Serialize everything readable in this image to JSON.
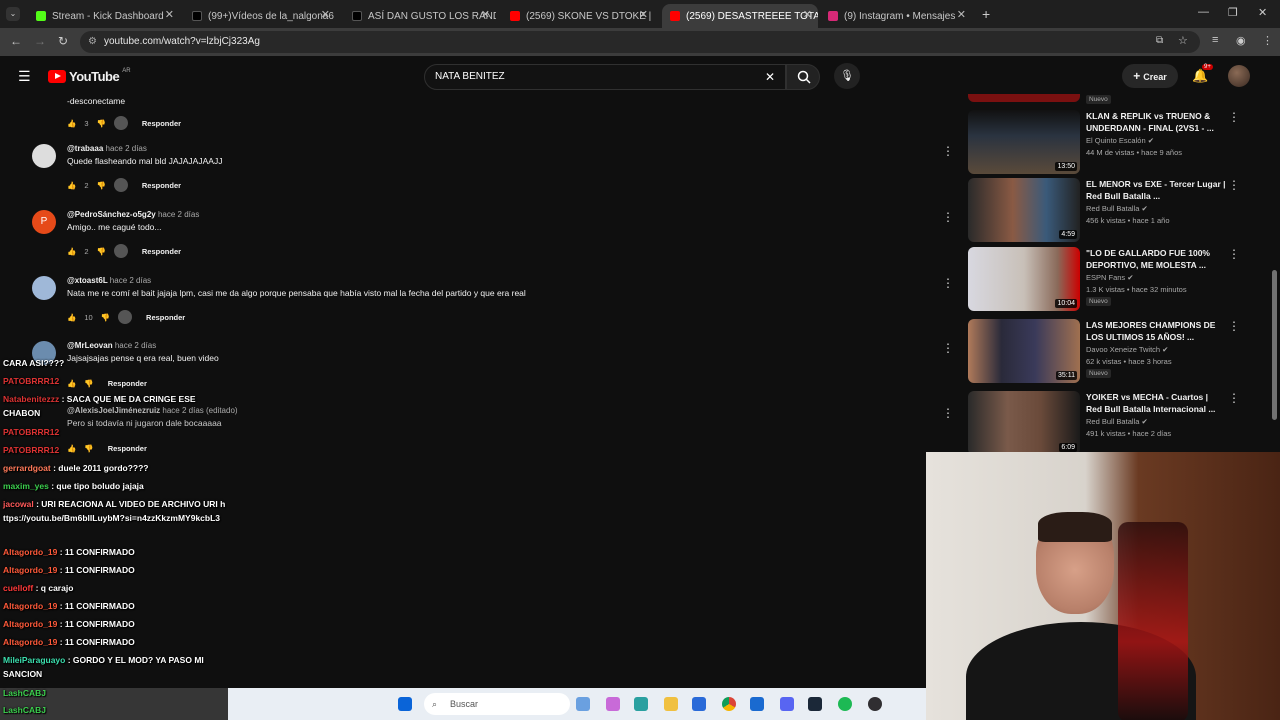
{
  "browser": {
    "tabs": [
      {
        "label": "Stream - Kick Dashboard",
        "color": "#53fc18"
      },
      {
        "label": "(99+)Vídeos de la_nalgona6 (@",
        "color": "#000000"
      },
      {
        "label": "ASÍ DAN GUSTO LOS RANDOM",
        "color": "#000000"
      },
      {
        "label": "(2569) SKONE VS DTOKE | FMS",
        "color": "#ff0000"
      },
      {
        "label": "(2569) DESASTREEEE TOTAL / B",
        "color": "#ff0000"
      },
      {
        "label": "(9) Instagram • Mensajes",
        "color": "#d62976"
      }
    ],
    "url": "youtube.com/watch?v=lzbjCj323Ag"
  },
  "youtube": {
    "logo_text": "YouTube",
    "region": "AR",
    "search_value": "NATA BENITEZ",
    "create_label": "Crear",
    "notif_count": "9+"
  },
  "comments": [
    {
      "author": "",
      "time": "",
      "text": "-desconectame",
      "likes": "3",
      "reply": "Responder"
    },
    {
      "author": "@trabaaa",
      "time": "hace 2 días",
      "text": "Quede flasheando mal bld JAJAJAJAAJJ",
      "likes": "2",
      "reply": "Responder"
    },
    {
      "author": "@PedroSánchez-o5g2y",
      "time": "hace 2 días",
      "text": "Amigo.. me cagué todo...",
      "likes": "2",
      "reply": "Responder"
    },
    {
      "author": "@xtoast6L",
      "time": "hace 2 días",
      "text": "Nata me re comí el bait jajaja lpm, casi me da algo porque pensaba que había visto mal la fecha del partido y que era real",
      "likes": "10",
      "reply": "Responder"
    },
    {
      "author": "@MrLeovan",
      "time": "hace 2 días",
      "text": "Jajsajsajas pense q era real, buen video",
      "likes": "",
      "reply": "Responder"
    },
    {
      "author": "@AlexisJoelJiménezruiz",
      "time": "hace 2 días (editado)",
      "text": "Pero si todavía ni jugaron   dale bocaaaaa",
      "likes": "",
      "reply": "Responder"
    }
  ],
  "sidebar_videos": [
    {
      "title": "KLAN & REPLIK vs TRUENO & UNDERDANN - FINAL (2VS1 - ...",
      "channel": "El Quinto Escalón",
      "meta": "44 M de vistas • hace 9 años",
      "duration": "13:50",
      "badge": ""
    },
    {
      "title": "EL MENOR vs EXE - Tercer Lugar | Red Bull Batalla ...",
      "channel": "Red Bull Batalla",
      "meta": "456 k vistas • hace 1 año",
      "duration": "4:59",
      "badge": ""
    },
    {
      "title": "\"LO DE GALLARDO FUE 100% DEPORTIVO, ME MOLESTA ...",
      "channel": "ESPN Fans",
      "meta": "1.3 K vistas • hace 32 minutos",
      "duration": "10:04",
      "badge": "Nuevo"
    },
    {
      "title": "LAS MEJORES CHAMPIONS DE LOS ULTIMOS 15 AÑOS! ...",
      "channel": "Davoo Xeneize Twitch",
      "meta": "62 k vistas • hace 3 horas",
      "duration": "35:11",
      "badge": "Nuevo"
    },
    {
      "title": "YOIKER vs MECHA - Cuartos | Red Bull Batalla Internacional ...",
      "channel": "Red Bull Batalla",
      "meta": "491 k vistas • hace 2 días",
      "duration": "6:09",
      "badge": ""
    }
  ],
  "top_badge": "Nuevo",
  "chat": [
    {
      "user": "",
      "msg": "CARA ASI????"
    },
    {
      "user": "PATOBRRR12",
      "msg": ""
    },
    {
      "user": "Natabenitezzz",
      "msg": "SACA QUE ME DA CRINGE ESE CHABON"
    },
    {
      "user": "PATOBRRR12",
      "msg": ""
    },
    {
      "user": "PATOBRRR12",
      "msg": ""
    },
    {
      "user": "gerrardgoat",
      "msg": "duele 2011 gordo????"
    },
    {
      "user": "maxim_yes",
      "msg": "que tipo boludo jajaja"
    },
    {
      "user": "jacowal",
      "msg": "URI REACIONA AL VIDEO DE ARCHIVO URI https://youtu.be/Bm6bllLuybM?si=n4zzKkzmMY9kcbL3"
    },
    {
      "user": "Altagordo_19",
      "msg": "11 CONFIRMADO"
    },
    {
      "user": "Altagordo_19",
      "msg": "11 CONFIRMADO"
    },
    {
      "user": "cuelloff",
      "msg": "q carajo"
    },
    {
      "user": "Altagordo_19",
      "msg": "11 CONFIRMADO"
    },
    {
      "user": "Altagordo_19",
      "msg": "11 CONFIRMADO"
    },
    {
      "user": "Altagordo_19",
      "msg": "11 CONFIRMADO"
    },
    {
      "user": "MileiParaguayo",
      "msg": "GORDO Y EL MOD? YA PASO MI SANCION"
    },
    {
      "user": "LashCABJ",
      "msg": ""
    },
    {
      "user": "LashCABJ",
      "msg": ""
    }
  ],
  "taskbar": {
    "search_placeholder": "Buscar"
  }
}
